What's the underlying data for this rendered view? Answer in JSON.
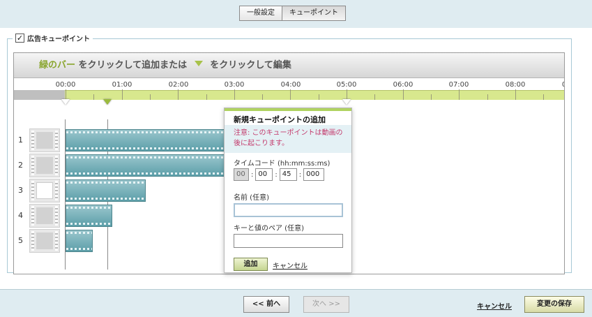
{
  "tabs": [
    {
      "label": "一般設定"
    },
    {
      "label": "キューポイント"
    }
  ],
  "section": {
    "checkbox_mark": "✓",
    "title": "広告キューポイント"
  },
  "instruction": {
    "green_bar": "緑のバー",
    "part1": "をクリックして追加または",
    "part2": "をクリックして編集"
  },
  "ruler_labels": [
    "00:00",
    "01:00",
    "02:00",
    "03:00",
    "04:00",
    "05:00",
    "06:00",
    "07:00",
    "08:00",
    "0"
  ],
  "rows": [
    {
      "num": "1",
      "thumb": "video"
    },
    {
      "num": "2",
      "thumb": "video"
    },
    {
      "num": "3",
      "thumb": "document"
    },
    {
      "num": "4",
      "thumb": "video"
    },
    {
      "num": "5",
      "thumb": "video"
    }
  ],
  "popup": {
    "title": "新規キューポイントの追加",
    "warning": "注意: このキューポイントは動画の後に起こります。",
    "timecode_label": "タイムコード (hh:mm:ss:ms)",
    "timecode": {
      "hh": "00",
      "mm": "00",
      "ss": "45",
      "ms": "000"
    },
    "separator": ":",
    "name_label": "名前 (任意)",
    "name_value": "",
    "kv_label": "キーと値のペア (任意)",
    "kv_value": "",
    "add_button": "追加",
    "cancel_link": "キャンセル"
  },
  "scrollbar": {
    "left_arrow": "◀",
    "right_arrow": "▶"
  },
  "footer": {
    "prev_button": "<< 前へ",
    "next_button": "次へ >>",
    "cancel_link": "キャンセル",
    "save_button": "変更の保存"
  },
  "colors": {
    "background": "#dfecf1",
    "ruler_green": "#d8e88e",
    "clip_teal": "#5d9fa9",
    "warning": "#c33a6c",
    "accent_green": "#8aa62f"
  }
}
